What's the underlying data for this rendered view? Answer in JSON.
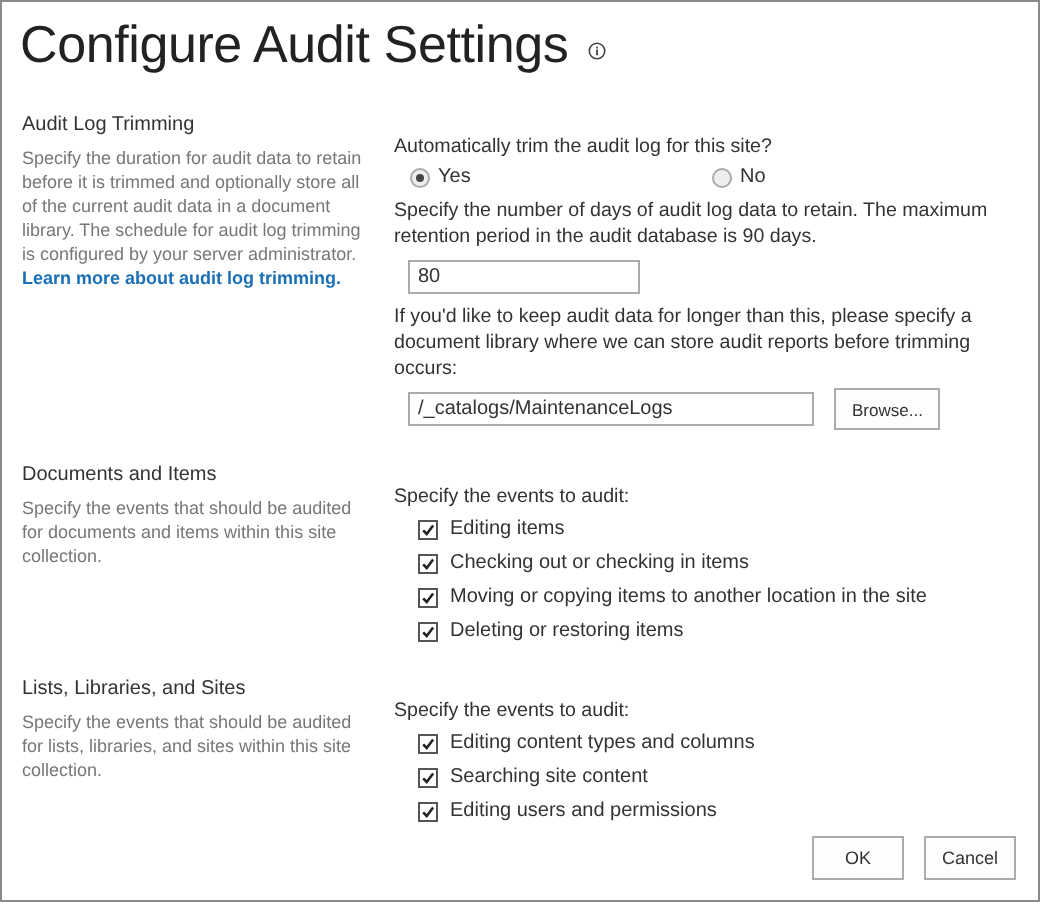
{
  "page": {
    "title": "Configure Audit Settings"
  },
  "sections": [
    {
      "title": "Audit Log Trimming",
      "description": "Specify the duration for audit data to retain before it is trimmed and optionally store all of the current audit data in a document library. The schedule for audit log trimming is configured by your server administrator.",
      "link": "Learn more about audit log trimming.",
      "controls": [
        {
          "kind": "radio",
          "label": "Automatically trim the audit log for this site?",
          "options": [
            {
              "label": "Yes",
              "selected": true
            },
            {
              "label": "No",
              "selected": false
            }
          ]
        },
        {
          "kind": "text",
          "label": "Specify the number of days of audit log data to retain. The maximum retention period in the audit database is 90 days.",
          "value": "80"
        },
        {
          "kind": "browse",
          "label": "If you'd like to keep audit data for longer than this, please specify a document library where we can store audit reports before trimming occurs:",
          "value": "/_catalogs/MaintenanceLogs",
          "button": "Browse..."
        }
      ]
    },
    {
      "title": "Documents and Items",
      "description": "Specify the events that should be audited for documents and items within this site collection.",
      "controls": [
        {
          "kind": "checklist",
          "label": "Specify the events to audit:",
          "items": [
            {
              "label": "Editing items",
              "checked": true
            },
            {
              "label": "Checking out or checking in items",
              "checked": true
            },
            {
              "label": "Moving or copying items to another location in the site",
              "checked": true
            },
            {
              "label": "Deleting or restoring items",
              "checked": true
            }
          ]
        }
      ]
    },
    {
      "title": "Lists, Libraries, and Sites",
      "description": "Specify the events that should be audited for lists, libraries, and sites within this site collection.",
      "controls": [
        {
          "kind": "checklist",
          "label": "Specify the events to audit:",
          "items": [
            {
              "label": "Editing content types and columns",
              "checked": true
            },
            {
              "label": "Searching site content",
              "checked": true
            },
            {
              "label": "Editing users and permissions",
              "checked": true
            }
          ]
        }
      ]
    }
  ],
  "buttons": [
    "OK",
    "Cancel"
  ]
}
